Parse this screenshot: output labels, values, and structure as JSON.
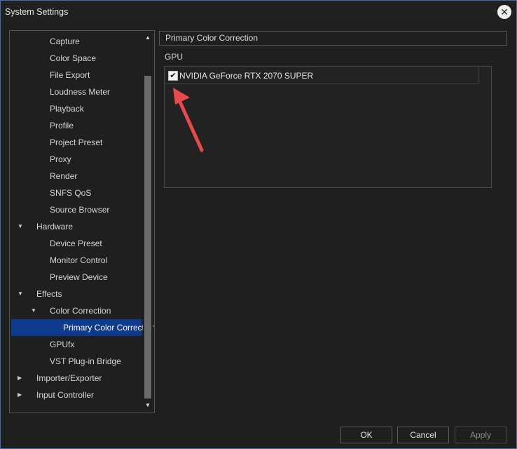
{
  "window": {
    "title": "System Settings"
  },
  "tree": {
    "items": [
      {
        "label": "Capture",
        "level": 2
      },
      {
        "label": "Color Space",
        "level": 2
      },
      {
        "label": "File Export",
        "level": 2
      },
      {
        "label": "Loudness Meter",
        "level": 2
      },
      {
        "label": "Playback",
        "level": 2
      },
      {
        "label": "Profile",
        "level": 2
      },
      {
        "label": "Project Preset",
        "level": 2
      },
      {
        "label": "Proxy",
        "level": 2
      },
      {
        "label": "Render",
        "level": 2
      },
      {
        "label": "SNFS QoS",
        "level": 2
      },
      {
        "label": "Source Browser",
        "level": 2
      },
      {
        "label": "Hardware",
        "level": 1,
        "expanded": true
      },
      {
        "label": "Device Preset",
        "level": 2
      },
      {
        "label": "Monitor Control",
        "level": 2
      },
      {
        "label": "Preview Device",
        "level": 2
      },
      {
        "label": "Effects",
        "level": 1,
        "expanded": true
      },
      {
        "label": "Color Correction",
        "level": 2,
        "expanded": true
      },
      {
        "label": "Primary Color Correction",
        "level": 3,
        "selected": true
      },
      {
        "label": "GPUfx",
        "level": 2
      },
      {
        "label": "VST Plug-in Bridge",
        "level": 2
      },
      {
        "label": "Importer/Exporter",
        "level": 1,
        "expanded": false
      },
      {
        "label": "Input Controller",
        "level": 1,
        "expanded": false
      }
    ]
  },
  "panel": {
    "header": "Primary Color Correction",
    "gpu_label": "GPU",
    "gpu_items": [
      {
        "name": "NVIDIA GeForce RTX 2070 SUPER",
        "checked": true
      }
    ]
  },
  "buttons": {
    "ok": "OK",
    "cancel": "Cancel",
    "apply": "Apply"
  },
  "colors": {
    "selection": "#0d3a8c",
    "annotation_arrow": "#e84a4a",
    "window_border": "#3a6fb0"
  }
}
